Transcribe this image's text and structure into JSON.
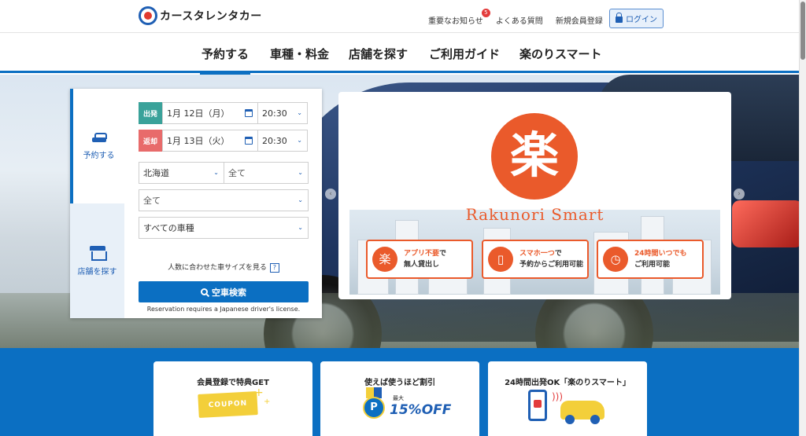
{
  "header": {
    "logo_text": "カースタレンタカー",
    "links": [
      {
        "label": "重要なお知らせ",
        "badge": "5"
      },
      {
        "label": "よくある質問"
      },
      {
        "label": "新規会員登録"
      }
    ],
    "login_label": "ログイン"
  },
  "nav": {
    "items": [
      "予約する",
      "車種・料金",
      "店舗を探す",
      "ご利用ガイド",
      "楽のりスマート"
    ],
    "active_index": 0
  },
  "reservation": {
    "tabs": [
      {
        "label": "予約する",
        "icon": "car-icon",
        "active": true
      },
      {
        "label": "店舗を探す",
        "icon": "store-icon",
        "active": false
      }
    ],
    "departure": {
      "label": "出発",
      "date": "1月 12日（月）",
      "time": "20:30"
    },
    "return": {
      "label": "返却",
      "date": "1月 13日（火）",
      "time": "20:30"
    },
    "region": "北海道",
    "area": "全て",
    "store": "全て",
    "vehicle_type": "すべての車種",
    "size_link": "人数に合わせた車サイズを見る",
    "help_mark": "?",
    "search_button": "空車検索",
    "note": "Reservation requires a Japanese driver's license."
  },
  "promo": {
    "kanji": "楽",
    "name": "Rakunori Smart",
    "features": [
      {
        "icon": "楽",
        "line1_hl": "アプリ不要",
        "line1_rest": "で",
        "line2": "無人貸出し"
      },
      {
        "icon": "▯",
        "line1_hl": "スマホ一つ",
        "line1_rest": "で",
        "line2": "予約からご利用可能"
      },
      {
        "icon": "◷",
        "line1_hl": "24時間いつでも",
        "line1_rest": "",
        "line2": "ご利用可能"
      }
    ]
  },
  "cards": [
    {
      "title": "会員登録で特典GET",
      "art_text": "COUPON"
    },
    {
      "title": "使えば使うほど割引",
      "art_small": "最大",
      "art_text": "15%OFF",
      "medal": "P"
    },
    {
      "title": "24時間出発OK「楽のりスマート」"
    }
  ],
  "colors": {
    "brand_blue": "#0b6fc2",
    "departure_green": "#3aa29a",
    "return_red": "#e86b6b",
    "raku_orange": "#ea5a2b",
    "coupon_yellow": "#f3cf3a"
  }
}
